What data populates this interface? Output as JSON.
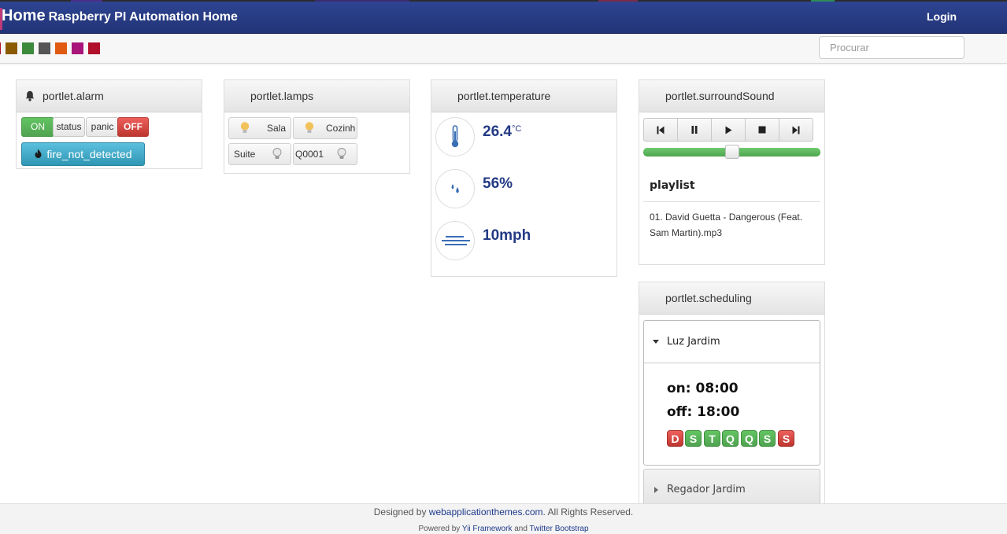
{
  "header": {
    "title": "Home",
    "subtitle": "Raspberry PI Automation Home",
    "login_label": "Login"
  },
  "toolbar": {
    "swatches": [
      "#8b5a00",
      "#3c8a3c",
      "#555555",
      "#e05a12",
      "#a8167a",
      "#b0102a"
    ],
    "search_placeholder": "Procurar"
  },
  "alarm": {
    "title": "portlet.alarm",
    "on_label": "ON",
    "status_label": "status",
    "panic_label": "panic",
    "off_label": "OFF",
    "fire_label": "fire_not_detected"
  },
  "lamps": {
    "title": "portlet.lamps",
    "items": [
      {
        "label": "Sala",
        "lit": true
      },
      {
        "label": "Cozinh",
        "lit": true
      },
      {
        "label": "Suite",
        "lit": false
      },
      {
        "label": "Q0001",
        "lit": false
      }
    ]
  },
  "temperature": {
    "title": "portlet.temperature",
    "temp_value": "26.4",
    "temp_unit": "°C",
    "humidity_value": "56%",
    "wind_value": "10mph"
  },
  "surround": {
    "title": "portlet.surroundSound",
    "volume_fraction": 0.5,
    "playlist_title": "playlist",
    "track": "01. David Guetta - Dangerous (Feat. Sam Martin).mp3"
  },
  "scheduling": {
    "title": "portlet.scheduling",
    "item1_name": "Luz Jardim",
    "on_time": "on: 08:00",
    "off_time": "off: 18:00",
    "days": [
      {
        "label": "D",
        "active": false
      },
      {
        "label": "S",
        "active": true
      },
      {
        "label": "T",
        "active": true
      },
      {
        "label": "Q",
        "active": true
      },
      {
        "label": "Q",
        "active": true
      },
      {
        "label": "S",
        "active": true
      },
      {
        "label": "S",
        "active": false
      }
    ],
    "item2_name": "Regador Jardim"
  },
  "footer": {
    "designed_prefix": "Designed by",
    "designed_link": "webapplicationthemes.com",
    "rights": ". All Rights Reserved.",
    "powered_prefix": "Powered by",
    "yii_link": "Yii Framework",
    "and": "and",
    "bootstrap_link": "Twitter Bootstrap"
  },
  "colors": {
    "header": "#2f4594",
    "success": "#51a351",
    "danger": "#bd362f",
    "info": "#2f96b4",
    "value_text": "#243a85"
  }
}
